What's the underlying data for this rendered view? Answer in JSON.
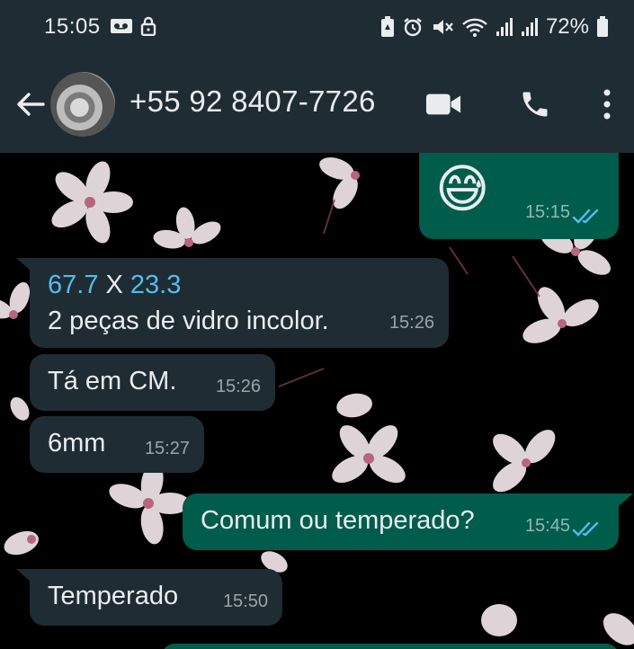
{
  "status_bar": {
    "time": "15:05",
    "battery_percent": "72%",
    "left_icons": [
      "voicemail-icon",
      "lock-icon"
    ],
    "right_icons": [
      "battery-saver-icon",
      "alarm-icon",
      "mute-icon",
      "wifi-icon",
      "signal-icon",
      "signal-icon",
      "battery-icon"
    ]
  },
  "header": {
    "contact_name": "+55 92 8407-7726",
    "icons": [
      "back-arrow-icon",
      "avatar",
      "video-call-icon",
      "phone-icon",
      "more-options-icon"
    ]
  },
  "messages": [
    {
      "direction": "out",
      "text": "😅",
      "time": "15:15",
      "read": true
    },
    {
      "direction": "in",
      "line1_a": "67.7",
      "line1_sep": " X ",
      "line1_b": "23.3",
      "line2": "2 peças de vidro incolor.",
      "time": "15:26"
    },
    {
      "direction": "in",
      "text": "Tá em CM.",
      "time": "15:26"
    },
    {
      "direction": "in",
      "text": "6mm",
      "time": "15:27"
    },
    {
      "direction": "out",
      "text": "Comum ou temperado?",
      "time": "15:45",
      "read": true
    },
    {
      "direction": "in",
      "text": "Temperado",
      "time": "15:50"
    }
  ],
  "colors": {
    "header_bg": "#1f2c34",
    "incoming_bubble": "#1f2c34",
    "outgoing_bubble": "#005c4b",
    "read_ticks": "#53bdeb",
    "link_number": "#53bdeb"
  }
}
